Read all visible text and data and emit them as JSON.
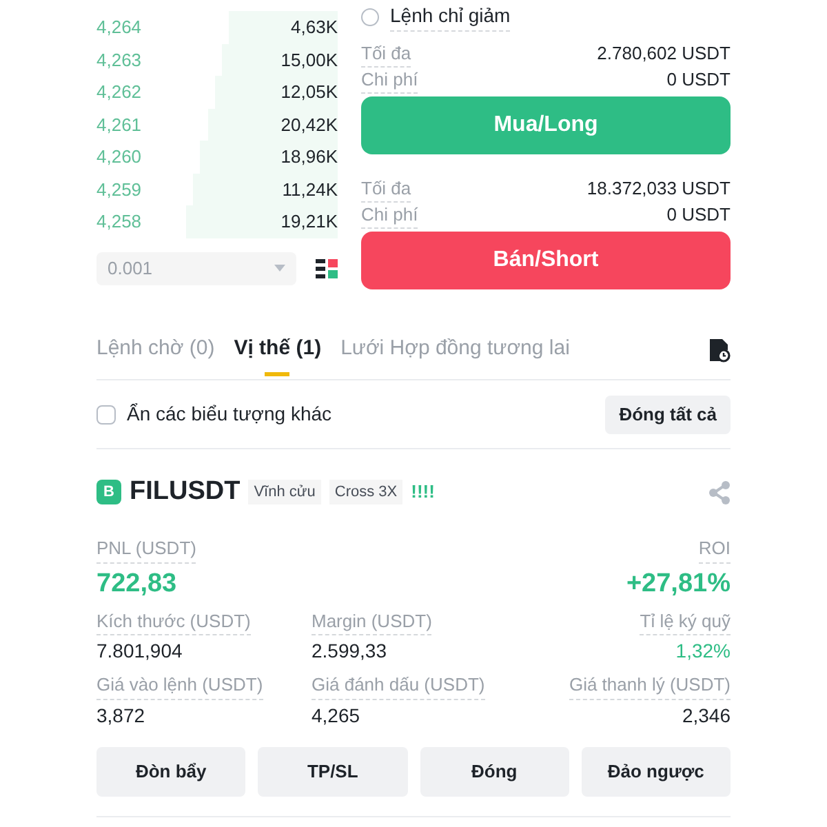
{
  "order_book": {
    "rows": [
      {
        "price": "4,264",
        "amount": "4,63K"
      },
      {
        "price": "4,263",
        "amount": "15,00K"
      },
      {
        "price": "4,262",
        "amount": "12,05K"
      },
      {
        "price": "4,261",
        "amount": "20,42K"
      },
      {
        "price": "4,260",
        "amount": "18,96K"
      },
      {
        "price": "4,259",
        "amount": "11,24K"
      },
      {
        "price": "4,258",
        "amount": "19,21K"
      }
    ],
    "tick_size": "0.001"
  },
  "order_panel": {
    "reduce_only": {
      "label": "Lệnh chỉ giảm",
      "checked": false
    },
    "buy": {
      "max_label": "Tối đa",
      "max": "2.780,602 USDT",
      "cost_label": "Chi phí",
      "cost": "0 USDT",
      "button": "Mua/Long"
    },
    "sell": {
      "max_label": "Tối đa",
      "max": "18.372,033 USDT",
      "cost_label": "Chi phí",
      "cost": "0 USDT",
      "button": "Bán/Short"
    }
  },
  "tabs": [
    {
      "label": "Lệnh chờ (0)",
      "selected": false
    },
    {
      "label": "Vị thế (1)",
      "selected": true
    },
    {
      "label": "Lưới Hợp đồng tương lai",
      "selected": false
    }
  ],
  "hide_others": {
    "label": "Ẩn các biểu tượng khác",
    "checked": false
  },
  "close_all": "Đóng tất cả",
  "position": {
    "side": "B",
    "symbol": "FILUSDT",
    "tags": [
      "Vĩnh cửu",
      "Cross 3X"
    ],
    "risk": "!!!!",
    "pnl": {
      "label": "PNL (USDT)",
      "value": "722,83"
    },
    "roi": {
      "label": "ROI",
      "value": "+27,81%"
    },
    "fields": [
      {
        "label": "Kích thước (USDT)",
        "value": "7.801,904",
        "positive": false
      },
      {
        "label": "Margin (USDT)",
        "value": "2.599,33",
        "positive": false
      },
      {
        "label": "Tỉ lệ ký quỹ",
        "value": "1,32%",
        "positive": true
      },
      {
        "label": "Giá vào lệnh (USDT)",
        "value": "3,872",
        "positive": false
      },
      {
        "label": "Giá đánh dấu (USDT)",
        "value": "4,265",
        "positive": false
      },
      {
        "label": "Giá thanh lý (USDT)",
        "value": "2,346",
        "positive": false
      }
    ],
    "actions": [
      "Đòn bẩy",
      "TP/SL",
      "Đóng",
      "Đảo ngược"
    ]
  }
}
